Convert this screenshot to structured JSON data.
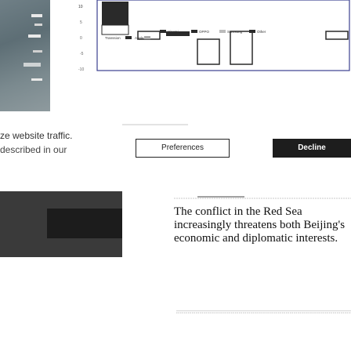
{
  "consent": {
    "line1": "ze website traffic.",
    "line2": "described in our",
    "preferences_label": "Preferences",
    "decline_label": "Decline"
  },
  "chart": {
    "top_tick": "10",
    "legend_items": [
      "Xiaomi",
      "OPPO",
      "Samsung",
      "Other"
    ],
    "legend_items_row2": [
      "Transsion",
      "Apple"
    ],
    "y_ticks": [
      "10",
      "5",
      "0",
      "-5",
      "-10"
    ]
  },
  "article": {
    "headline": "The conflict in the Red Sea increasingly threatens both Beijing's economic and diplomatic interests."
  },
  "colors": {
    "accent_dark": "#1d1d1d",
    "chart_bar_dark": "#2a2a2a",
    "chart_bar_light": "#ffffff",
    "chart_border": "#3b3f8f"
  }
}
